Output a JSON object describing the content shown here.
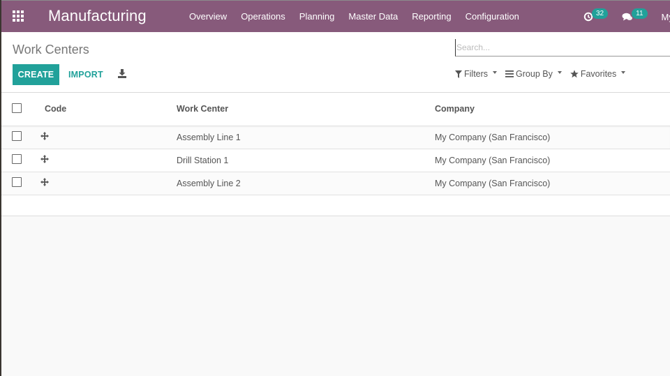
{
  "navbar": {
    "app_name": "Manufacturing",
    "apps_icon": "grid-icon",
    "menu": [
      {
        "label": "Overview"
      },
      {
        "label": "Operations"
      },
      {
        "label": "Planning"
      },
      {
        "label": "Master Data"
      },
      {
        "label": "Reporting"
      },
      {
        "label": "Configuration"
      }
    ],
    "activities_badge": "32",
    "messages_badge": "11",
    "user_label": "My",
    "colors": {
      "bar": "#875a7b",
      "badge": "#21a19a"
    }
  },
  "control_panel": {
    "breadcrumb": "Work Centers",
    "create_label": "CREATE",
    "import_label": "IMPORT",
    "search_placeholder": "Search...",
    "filters_label": "Filters",
    "group_by_label": "Group By",
    "favorites_label": "Favorites",
    "accent": "#21a19a"
  },
  "table": {
    "columns": [
      {
        "label": "Code"
      },
      {
        "label": "Work Center"
      },
      {
        "label": "Company"
      }
    ],
    "rows": [
      {
        "code": "",
        "work_center": "Assembly Line 1",
        "company": "My Company (San Francisco)"
      },
      {
        "code": "",
        "work_center": "Drill Station 1",
        "company": "My Company (San Francisco)"
      },
      {
        "code": "",
        "work_center": "Assembly Line 2",
        "company": "My Company (San Francisco)"
      }
    ]
  }
}
